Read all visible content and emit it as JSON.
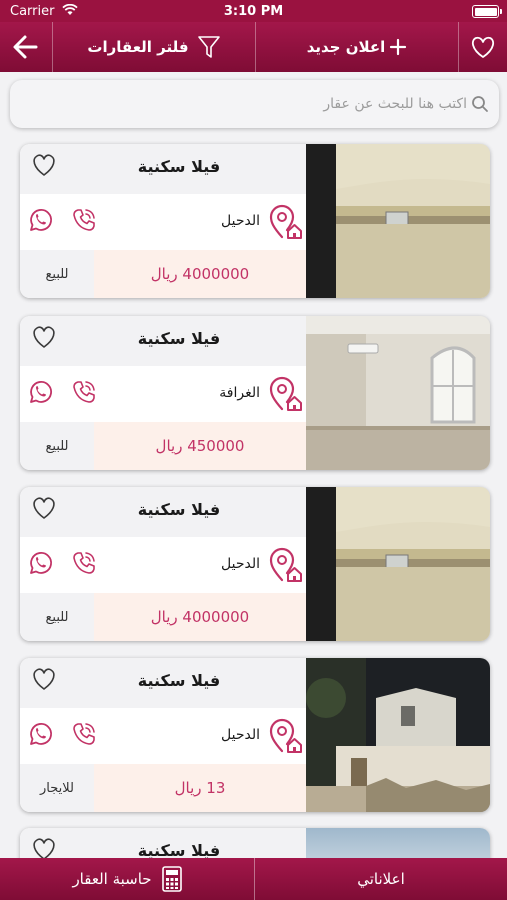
{
  "status_bar": {
    "carrier": "Carrier",
    "time": "3:10 PM"
  },
  "nav": {
    "filter_label": "فلتر العقارات",
    "new_ad_label": "اعلان جديد",
    "icons": [
      "back-arrow-icon",
      "filter-funnel-icon",
      "plus-icon",
      "heart-icon"
    ]
  },
  "search": {
    "placeholder": "اكتب هنا للبحث عن عقار",
    "icon": "magnifier-icon"
  },
  "listings": [
    {
      "title": "فيلا سكنية",
      "location": "الدحيل",
      "price": "4000000 ريال",
      "type": "للبيع",
      "photo": "villa-exterior-ac"
    },
    {
      "title": "فيلا سكنية",
      "location": "الغرافة",
      "price": "450000 ريال",
      "type": "للبيع",
      "photo": "villa-interior-window"
    },
    {
      "title": "فيلا سكنية",
      "location": "الدحيل",
      "price": "4000000 ريال",
      "type": "للبيع",
      "photo": "villa-exterior-ac"
    },
    {
      "title": "فيلا سكنية",
      "location": "الدحيل",
      "price": "13 ريال",
      "type": "للايجار",
      "photo": "villa-night"
    },
    {
      "title": "فيلا سكنية",
      "photo": "sky"
    }
  ],
  "tabbar": {
    "calculator_label": "حاسبة العقار",
    "my_ads_label": "اعلاناتي"
  },
  "colors": {
    "brand": "#9a1240",
    "accent": "#c23366",
    "price_bg": "#fdf0ea",
    "cell_bg": "#f2f2f4"
  }
}
